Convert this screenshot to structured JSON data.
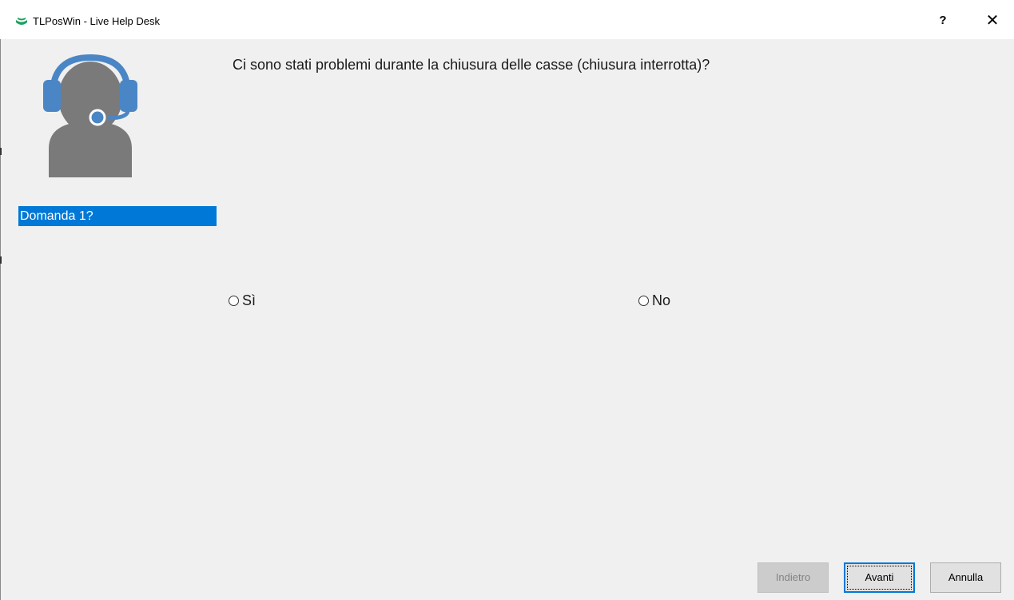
{
  "window": {
    "title": "TLPosWin - Live Help Desk",
    "help_label": "?",
    "close_label": "✕"
  },
  "sidebar": {
    "steps": [
      {
        "label": "Domanda 1?",
        "selected": true
      }
    ]
  },
  "main": {
    "question": "Ci sono stati problemi durante la chiusura delle casse (chiusura interrotta)?",
    "options": [
      {
        "label": "Sì",
        "checked": false
      },
      {
        "label": "No",
        "checked": false
      }
    ]
  },
  "buttons": {
    "back_label": "Indietro",
    "next_label": "Avanti",
    "cancel_label": "Annulla"
  },
  "colors": {
    "accent": "#0078d7",
    "headset": "#4a86c5",
    "silhouette": "#7a7a7a",
    "app_icon": "#1aa260"
  },
  "icons": {
    "app": "tlposwin-logo-icon",
    "avatar": "support-agent-headset-icon"
  }
}
